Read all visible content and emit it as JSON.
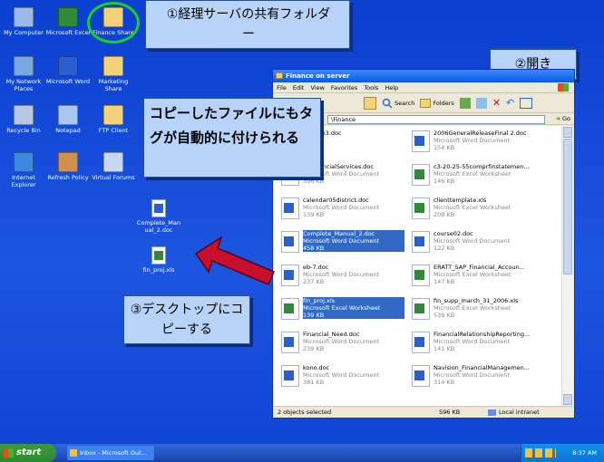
{
  "desktop_icons": [
    {
      "label": "My Computer",
      "icon": "computer-icon"
    },
    {
      "label": "Microsoft Excel",
      "icon": "excel-icon"
    },
    {
      "label": "Finance Share",
      "icon": "shared-folder-icon"
    },
    {
      "label": "My Network Places",
      "icon": "network-icon"
    },
    {
      "label": "Microsoft Word",
      "icon": "word-icon"
    },
    {
      "label": "Marketing Share",
      "icon": "shared-folder-icon"
    },
    {
      "label": "Recycle Bin",
      "icon": "recycle-bin-icon"
    },
    {
      "label": "Notepad",
      "icon": "notepad-icon"
    },
    {
      "label": "FTP Client",
      "icon": "ftp-icon"
    },
    {
      "label": "Internet Explorer",
      "icon": "ie-icon"
    },
    {
      "label": "Refresh Policy",
      "icon": "users-icon"
    },
    {
      "label": "Virtual Forums",
      "icon": "forums-icon"
    }
  ],
  "desktop_files": [
    {
      "label": "Complete_Manual_2.doc",
      "icon": "word-doc-icon"
    },
    {
      "label": "fin_proj.xls",
      "icon": "excel-doc-icon"
    }
  ],
  "callouts": {
    "share_folder": "①経理サーバの共有フォルダー",
    "open": "②開き",
    "auto_tag": "コピーしたファイルにもタグが自動的に付けられる",
    "copy_desktop": "③デスクトップにコピーする"
  },
  "window": {
    "title": "Finance on server",
    "menu": [
      "File",
      "Edit",
      "View",
      "Favorites",
      "Tools",
      "Help"
    ],
    "toolbar": {
      "search": "Search",
      "folders": "Folders"
    },
    "address": "\\Finance",
    "go": "Go",
    "files": [
      {
        "name": "ugForm3.doc",
        "type": "",
        "size": "",
        "kind": "word"
      },
      {
        "name": "2006GeneralReleaseFinal 2.doc",
        "type": "Microsoft Word Document",
        "size": "154 KB",
        "kind": "word"
      },
      {
        "name": "APFinancialServices.doc",
        "type": "Microsoft Word Document",
        "size": "396 KB",
        "kind": "word"
      },
      {
        "name": "c3-20-25-55comprfinstatemen...",
        "type": "Microsoft Excel Worksheet",
        "size": "146 KB",
        "kind": "excel"
      },
      {
        "name": "calendar05district.doc",
        "type": "Microsoft Word Document",
        "size": "139 KB",
        "kind": "word"
      },
      {
        "name": "clienttemplate.xls",
        "type": "Microsoft Excel Worksheet",
        "size": "208 KB",
        "kind": "excel"
      },
      {
        "name": "Complete_Manual_2.doc",
        "type": "Microsoft Word Document",
        "size": "458 KB",
        "kind": "word",
        "selected": true
      },
      {
        "name": "course02.doc",
        "type": "Microsoft Word Document",
        "size": "122 KB",
        "kind": "word"
      },
      {
        "name": "eb-7.doc",
        "type": "Microsoft Word Document",
        "size": "237 KB",
        "kind": "word"
      },
      {
        "name": "ERATT_SAP_Financial_Accoun...",
        "type": "Microsoft Excel Worksheet",
        "size": "147 KB",
        "kind": "excel"
      },
      {
        "name": "fin_proj.xls",
        "type": "Microsoft Excel Worksheet",
        "size": "139 KB",
        "kind": "excel",
        "selected": true
      },
      {
        "name": "fin_supp_march_31_2006.xls",
        "type": "Microsoft Excel Worksheet",
        "size": "539 KB",
        "kind": "excel"
      },
      {
        "name": "Financial_Need.doc",
        "type": "Microsoft Word Document",
        "size": "239 KB",
        "kind": "word"
      },
      {
        "name": "FinancialRelationshipReporting...",
        "type": "Microsoft Word Document",
        "size": "141 KB",
        "kind": "word"
      },
      {
        "name": "kono.doc",
        "type": "Microsoft Word Document",
        "size": "381 KB",
        "kind": "word"
      },
      {
        "name": "Navision_FinancialManagemen...",
        "type": "Microsoft Word Document",
        "size": "314 KB",
        "kind": "word"
      }
    ],
    "status": {
      "selected": "2 objects selected",
      "size": "596 KB",
      "zone": "Local intranet"
    }
  },
  "taskbar": {
    "start": "start",
    "task": "Inbox - Microsoft Out...",
    "clock": "8:37 AM"
  },
  "colors": {
    "desktop": "#1a4ed8",
    "highlight_ring": "#1fcf1f",
    "arrow": "#c8102e",
    "selection": "#316ac5"
  }
}
